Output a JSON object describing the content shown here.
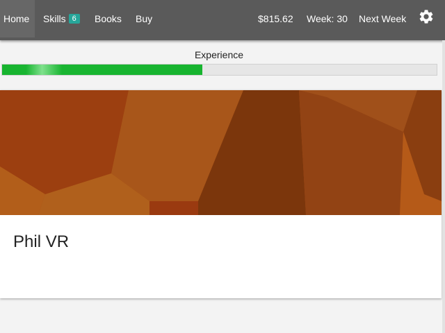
{
  "nav": {
    "home": "Home",
    "skills": "Skills",
    "skills_badge": "6",
    "books": "Books",
    "buy": "Buy",
    "money": "$815.62",
    "week": "Week: 30",
    "next_week": "Next Week",
    "settings_icon": "gear-icon"
  },
  "experience": {
    "label": "Experience",
    "progress_percent": 46
  },
  "card": {
    "title": "Phil VR"
  },
  "colors": {
    "navbar": "#5a5a5a",
    "badge": "#26a69a",
    "progress_fill": "#17b42f",
    "card_art_base": "#a94f14"
  }
}
